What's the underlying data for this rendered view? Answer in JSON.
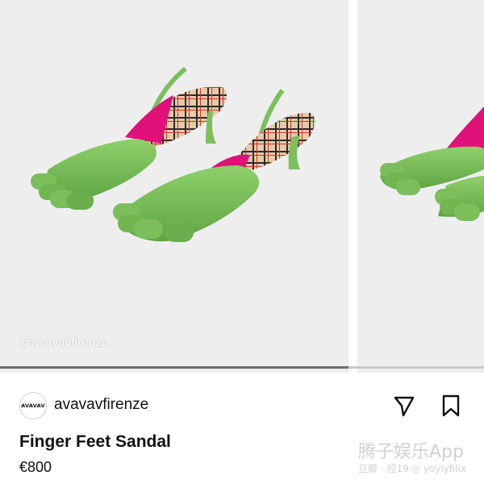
{
  "media": {
    "watermark": "@avavavfirenze",
    "carousel_progress": 0.72,
    "slides": [
      {
        "description_icon": "product-photo-sandals"
      },
      {
        "description_icon": "product-photo-sandals-partial"
      }
    ]
  },
  "post": {
    "account_name": "avavavfirenze",
    "avatar_text": "AVAVAV",
    "actions": {
      "share_icon": "paper-plane-icon",
      "save_icon": "bookmark-icon"
    }
  },
  "product": {
    "name": "Finger Feet Sandal",
    "price": "€800"
  },
  "overlay_brand": {
    "line1": "腾子娱乐App",
    "line2": "豆瓣 · 短19 ◎ yoyiyfilix"
  },
  "colors": {
    "shoe_green": "#7cbf5a",
    "lining_pink": "#e0127a",
    "background": "#eeeeef"
  }
}
